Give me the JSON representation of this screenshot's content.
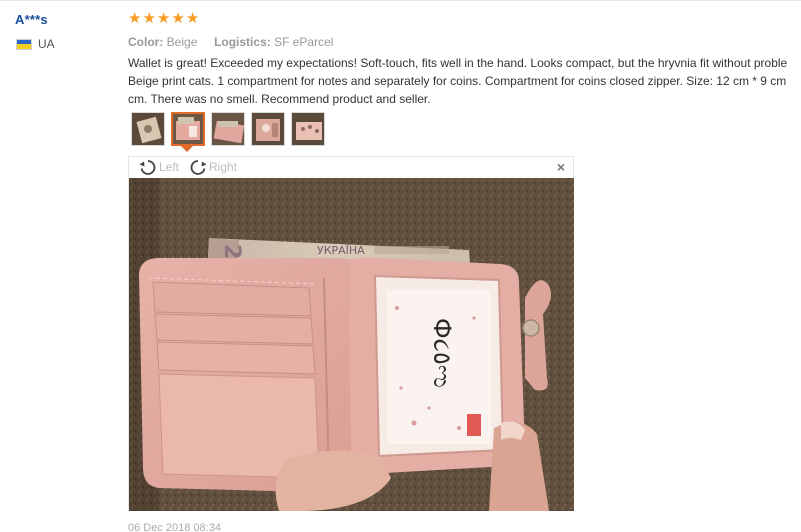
{
  "user": {
    "name": "A***s",
    "country_code": "UA"
  },
  "review": {
    "rating": 5,
    "rating_icons": [
      "star-icon",
      "star-icon",
      "star-icon",
      "star-icon",
      "star-icon"
    ],
    "color_label": "Color:",
    "color_value": "Beige",
    "logistics_label": "Logistics:",
    "logistics_value": "SF eParcel",
    "text_lines": [
      "Wallet is great! Exceeded my expectations! Soft-touch, fits well in the hand. Looks compact, but the hryvnia fit without proble",
      "Beige print cats. 1 compartment for notes and separately for coins. Compartment for coins closed zipper. Size: 12 cm * 9 cm",
      "cm. There was no smell. Recommend product and seller."
    ],
    "date": "06 Dec 2018 08:34"
  },
  "viewer": {
    "rotate_left_label": "Left",
    "rotate_right_label": "Right",
    "close_label": "×"
  },
  "photo": {
    "banknote_value": "200",
    "banknote_country": "УКРАЇНА",
    "card_text": "Ф૮٥ಌ"
  },
  "colors": {
    "username": "#1a4f9c",
    "star": "#f79b22",
    "active_thumb": "#e06b2b",
    "wallet_pink": "#e9b3a9",
    "carpet": "#6e5a46"
  }
}
